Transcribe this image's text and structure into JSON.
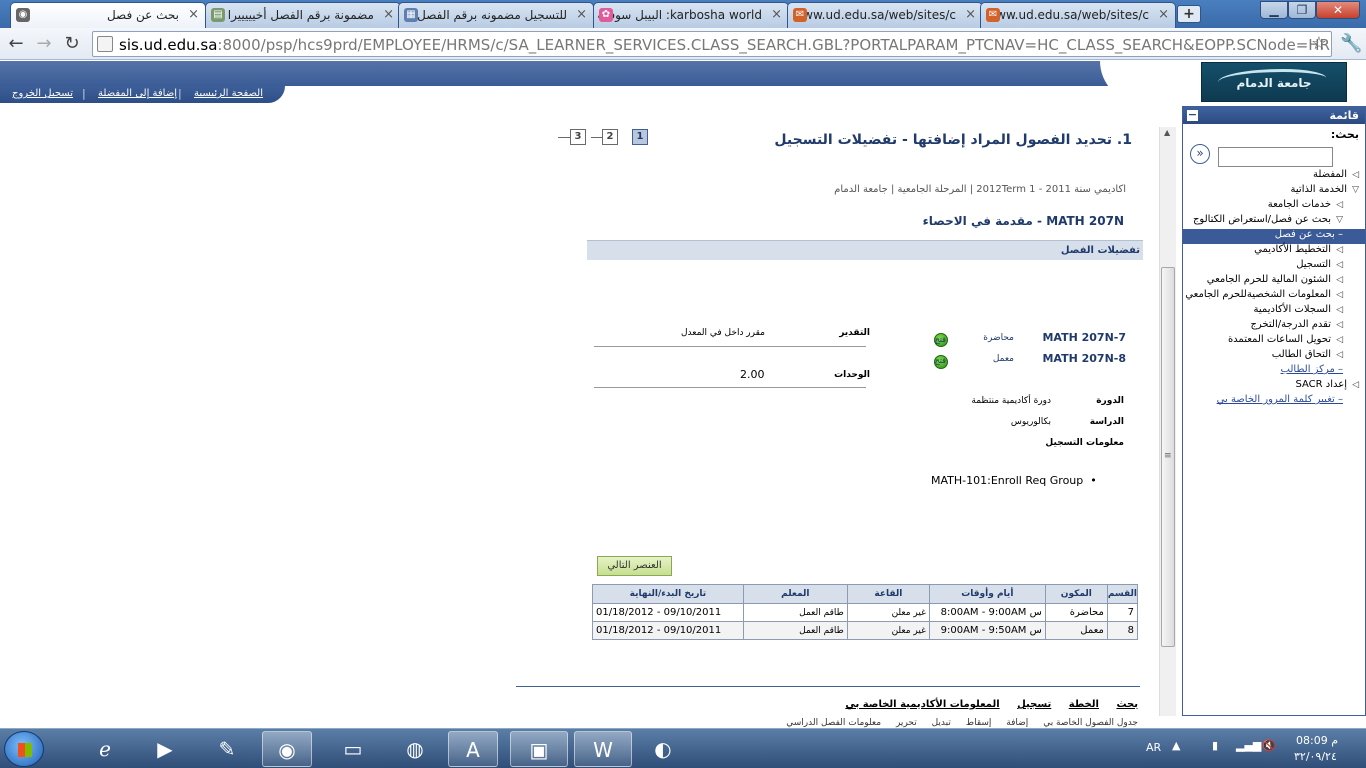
{
  "browser": {
    "tabs": [
      {
        "title": "بحث عن فصل",
        "active": true,
        "icon": "peoplesoft-icon"
      },
      {
        "title": "مضمونة برقم الفصل أخيييييرا",
        "active": false,
        "icon": "forum-icon"
      },
      {
        "title": "للتسجيل مضمونه برقم الفصل",
        "active": false,
        "icon": "document-icon"
      },
      {
        "title": "karbosha world: البيبل سوفت",
        "active": false,
        "icon": "flower-icon"
      },
      {
        "title": "www.ud.edu.sa/web/sites/c",
        "active": false,
        "icon": "ud-icon"
      },
      {
        "title": "www.ud.edu.sa/web/sites/c",
        "active": false,
        "icon": "ud-icon"
      }
    ],
    "url_host": "sis.ud.edu.sa",
    "url_rest": ":8000/psp/hcs9prd/EMPLOYEE/HRMS/c/SA_LEARNER_SERVICES.CLASS_SEARCH.GBL?PORTALPARAM_PTCNAV=HC_CLASS_SEARCH&EOPP.SCNode=HRMS&EOPP.SCPor"
  },
  "header": {
    "links": [
      "الصفحة الرئيسية",
      "إضافة إلى المفضلة",
      "تسجيل الخروج"
    ],
    "logo_text": "جامعة الدمام"
  },
  "sidebar": {
    "title": "قائمة",
    "search_label": "بحث:",
    "items": [
      {
        "label": "المفضلة",
        "level": 1,
        "kind": "collapsed"
      },
      {
        "label": "الخدمة الذاتية",
        "level": 1,
        "kind": "expanded"
      },
      {
        "label": "خدمات الجامعة",
        "level": 2,
        "kind": "collapsed"
      },
      {
        "label": "بحث عن فصل/استعراض الكتالوج",
        "level": 2,
        "kind": "expanded"
      },
      {
        "label": "– بحث عن فصل",
        "level": 3,
        "kind": "selected"
      },
      {
        "label": "التخطيط الأكاديمي",
        "level": 2,
        "kind": "collapsed"
      },
      {
        "label": "التسجيل",
        "level": 2,
        "kind": "collapsed"
      },
      {
        "label": "الشئون المالية للحرم الجامعي",
        "level": 2,
        "kind": "collapsed"
      },
      {
        "label": "المعلومات الشخصيةللحرم الجامعي",
        "level": 2,
        "kind": "collapsed"
      },
      {
        "label": "السجلات الأكاديمية",
        "level": 2,
        "kind": "collapsed"
      },
      {
        "label": "تقدم الدرجة/التخرج",
        "level": 2,
        "kind": "collapsed"
      },
      {
        "label": "تحويل الساعات المعتمدة",
        "level": 2,
        "kind": "collapsed"
      },
      {
        "label": "التحاق الطالب",
        "level": 2,
        "kind": "collapsed"
      },
      {
        "label": "– مركز الطالب",
        "level": 2,
        "kind": "link"
      },
      {
        "label": "إعداد SACR",
        "level": 1,
        "kind": "collapsed"
      },
      {
        "label": "– تغيير كلمة المرور الخاصة بي",
        "level": 1,
        "kind": "link"
      }
    ]
  },
  "page": {
    "step_title": "1. تحديد الفصول المراد إضافتها - تفضيلات التسجيل",
    "steps": [
      "1",
      "2",
      "3"
    ],
    "breadcrumb": "اكاديمي سنة 2011 - 1 2012Term | المرحلة الجامعية | جامعة الدمام",
    "course_code": "MATH  207N",
    "course_name": "- مقدمة في الاحصاء",
    "section_header": "تفضيلات الفصل",
    "classes": [
      {
        "code": "MATH  207N-7",
        "type": "محاضرة",
        "status": "فتح"
      },
      {
        "code": "MATH  207N-8",
        "type": "معمل",
        "status": "فتح"
      }
    ],
    "grading_label": "التقدير",
    "grading_value": "مقرر داخل في المعدل",
    "units_label": "الوحدات",
    "units_value": "2.00",
    "session_label": "الدورة",
    "session_value": "دورة أكاديمية منتظمة",
    "career_label": "الدراسة",
    "career_value": "بكالوريوس",
    "enroll_info_label": "معلومات التسجيل",
    "enroll_req": "MATH-101:Enroll Req Group",
    "next_button": "العنصر التالي",
    "table": {
      "headers": [
        "القسم",
        "المكون",
        "أيام وأوقات",
        "القاعة",
        "المعلم",
        "تاريخ البدء/النهاية"
      ],
      "rows": [
        [
          "7",
          "محاضرة",
          "س 8:00AM - 9:00AM",
          "غير معلن",
          "طاقم العمل",
          "01/18/2012 - 09/10/2011"
        ],
        [
          "8",
          "معمل",
          "س 9:00AM - 9:50AM",
          "غير معلن",
          "طاقم العمل",
          "01/18/2012 - 09/10/2011"
        ]
      ]
    },
    "footer_links": [
      "بحث",
      "الخطة",
      "تسجيل",
      "المعلومات الأكاديمية الخاصة بي"
    ],
    "footer_sub": [
      "جدول الفصول الخاصة بي",
      "إضافة",
      "إسقاط",
      "تبديل",
      "تحرير",
      "معلومات الفصل الدراسي"
    ]
  },
  "taskbar": {
    "apps": [
      "ie-icon",
      "media-player-icon",
      "tools-icon",
      "chrome-icon",
      "explorer-folder-icon",
      "firefox-icon",
      "acrobat-icon",
      "picture-viewer-icon",
      "word-icon",
      "sync-icon"
    ],
    "lang": "AR",
    "time": "08:09 م",
    "date": "٣٢/٠٩/٢٤"
  }
}
